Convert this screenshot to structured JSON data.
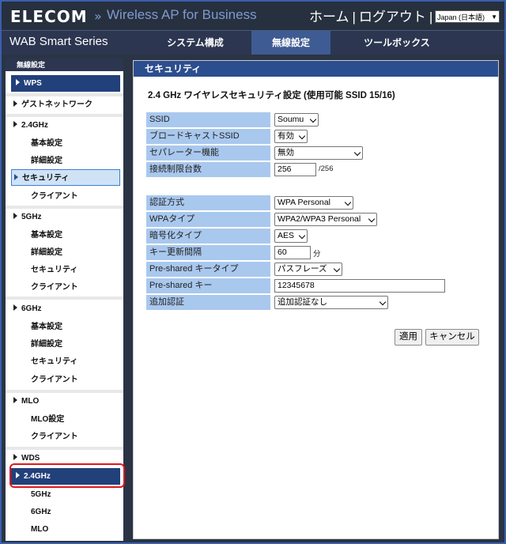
{
  "header": {
    "logo": "ELECOM",
    "chevron": "»",
    "product": "Wireless AP for Business",
    "home": "ホーム",
    "divider": "|",
    "logout": "ログアウト",
    "language": "Japan (日本語)"
  },
  "nav": {
    "series": "WAB Smart Series",
    "tabs": [
      "システム構成",
      "無線設定",
      "ツールボックス"
    ],
    "active_tab": "無線設定"
  },
  "sidebar": {
    "heading": "無線設定",
    "items": [
      {
        "label": "WPS"
      },
      {
        "label": "ゲストネットワーク"
      },
      {
        "label": "2.4GHz"
      },
      {
        "label": "基本設定"
      },
      {
        "label": "詳細設定"
      },
      {
        "label": "セキュリティ"
      },
      {
        "label": "クライアント"
      },
      {
        "label": "5GHz"
      },
      {
        "label": "基本設定"
      },
      {
        "label": "詳細設定"
      },
      {
        "label": "セキュリティ"
      },
      {
        "label": "クライアント"
      },
      {
        "label": "6GHz"
      },
      {
        "label": "基本設定"
      },
      {
        "label": "詳細設定"
      },
      {
        "label": "セキュリティ"
      },
      {
        "label": "クライアント"
      },
      {
        "label": "MLO"
      },
      {
        "label": "MLO設定"
      },
      {
        "label": "クライアント"
      },
      {
        "label": "WDS"
      },
      {
        "label": "2.4GHz"
      },
      {
        "label": "5GHz"
      },
      {
        "label": "6GHz"
      },
      {
        "label": "MLO"
      }
    ]
  },
  "content": {
    "heading": "セキュリティ",
    "section_title": "2.4 GHz ワイヤレスセキュリティ設定 (使用可能 SSID 15/16)",
    "fields": {
      "ssid": {
        "label": "SSID",
        "value": "Soumu"
      },
      "broadcast": {
        "label": "ブロードキャストSSID",
        "value": "有効"
      },
      "separator": {
        "label": "セパレーター機能",
        "value": "無効"
      },
      "limit": {
        "label": "接続制限台数",
        "value": "256",
        "max": "/256"
      },
      "auth": {
        "label": "認証方式",
        "value": "WPA Personal"
      },
      "wpa_type": {
        "label": "WPAタイプ",
        "value": "WPA2/WPA3 Personal"
      },
      "encryption": {
        "label": "暗号化タイプ",
        "value": "AES"
      },
      "key_interval": {
        "label": "キー更新間隔",
        "value": "60",
        "unit": "分"
      },
      "psk_type": {
        "label": "Pre-shared キータイプ",
        "value": "パスフレーズ"
      },
      "psk": {
        "label": "Pre-shared キー",
        "value": "12345678"
      },
      "extra_auth": {
        "label": "追加認証",
        "value": "追加認証なし"
      }
    },
    "buttons": {
      "apply": "適用",
      "cancel": "キャンセル"
    }
  },
  "colors": {
    "header_bg": "#27303e",
    "nav_active": "#3f5b93",
    "content_head": "#2c4e8f",
    "label_bg": "#a9c8ee",
    "sidebar_active": "#22407a",
    "highlight": "#e0161b"
  }
}
